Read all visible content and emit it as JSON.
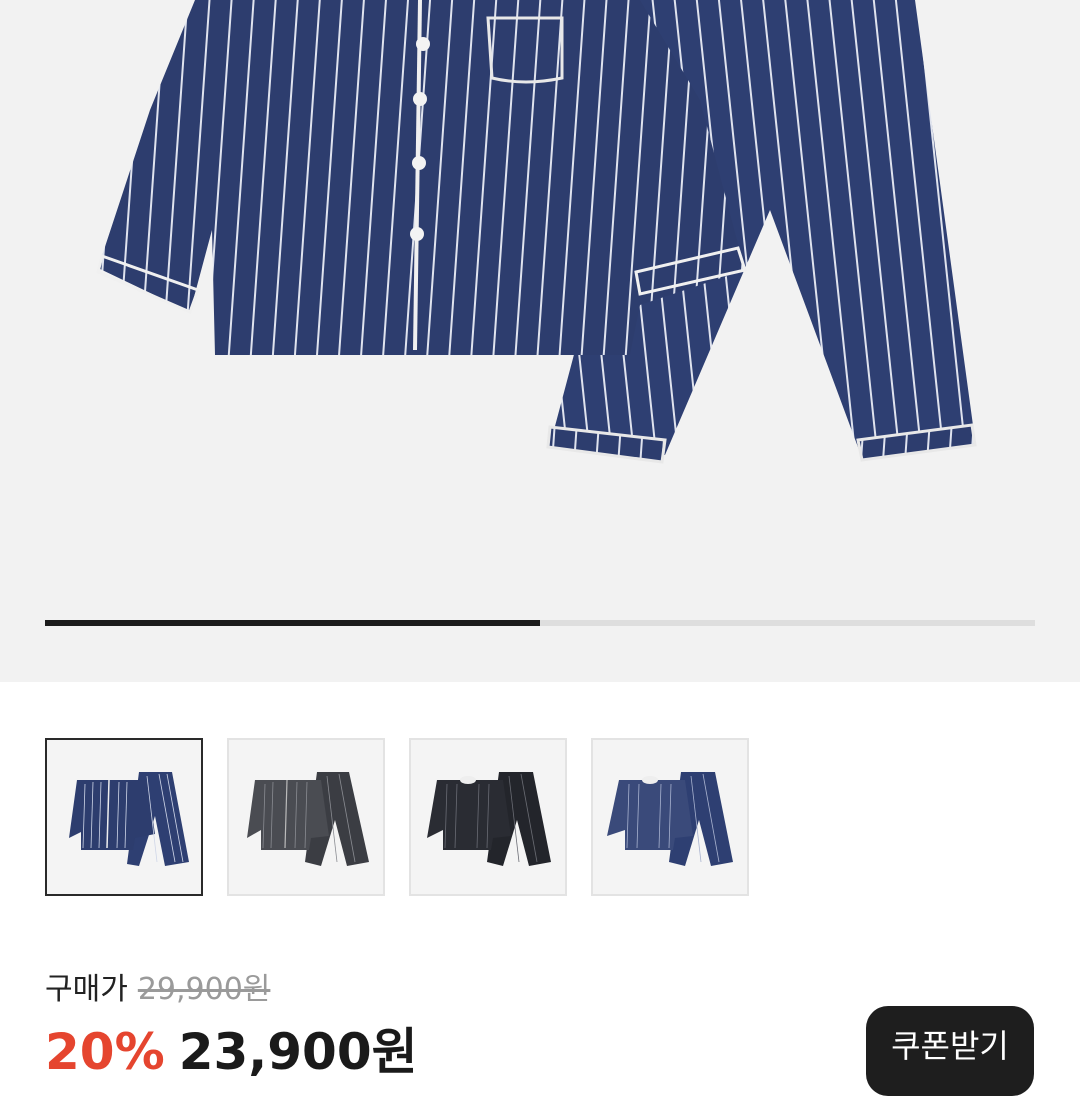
{
  "product": {
    "image_count_progress": 0.5,
    "thumbnails": [
      {
        "name": "navy-stripe-shirt-pajama",
        "selected": true
      },
      {
        "name": "charcoal-stripe-shirt-pajama",
        "selected": false
      },
      {
        "name": "black-stripe-henley-pajama",
        "selected": false
      },
      {
        "name": "navy-stripe-henley-pajama",
        "selected": false
      }
    ]
  },
  "price": {
    "label": "구매가",
    "original": "29,900원",
    "discount": "20%",
    "sale": "23,900원"
  },
  "coupon": {
    "label": "쿠폰받기"
  },
  "colors": {
    "navy": "#2d3d6e",
    "charcoal": "#4a4c52",
    "black": "#2a2c33",
    "discount_red": "#e5452f"
  }
}
